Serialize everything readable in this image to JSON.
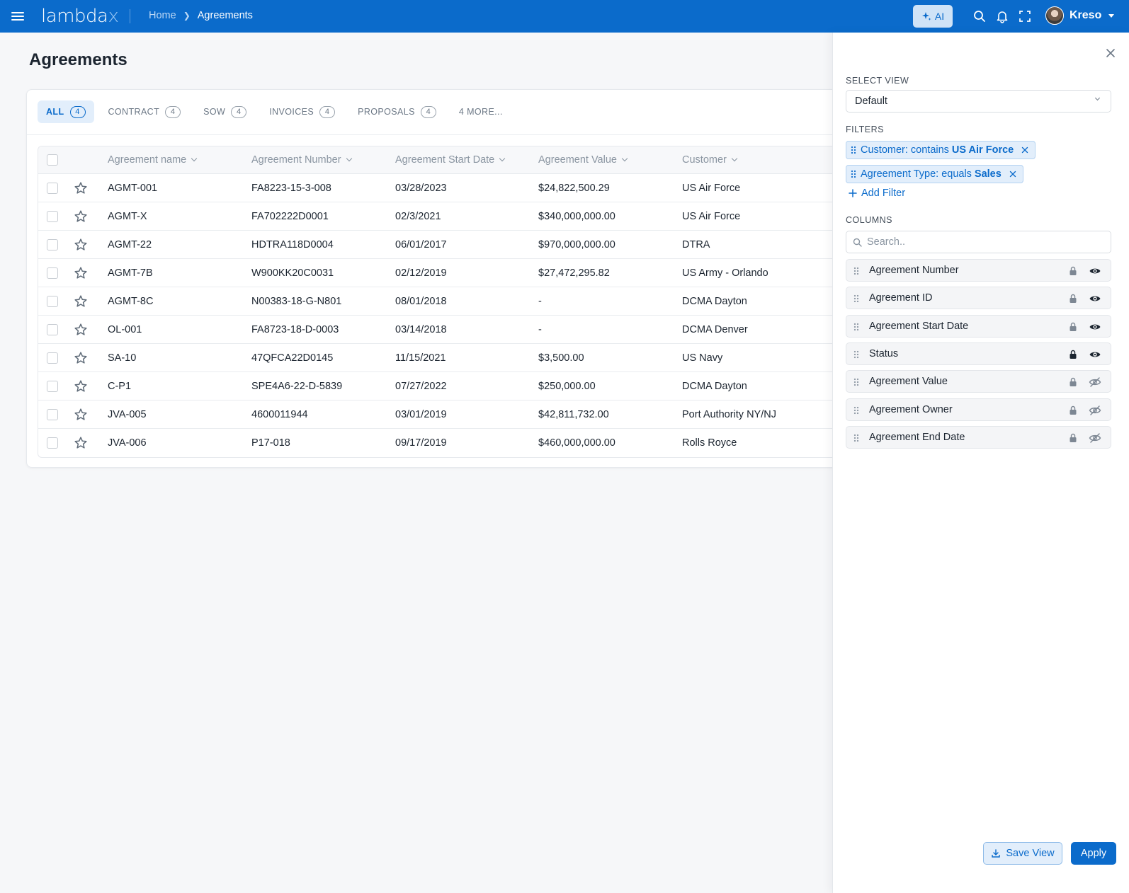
{
  "app": {
    "logo_main": "lambda",
    "logo_accent": "x"
  },
  "breadcrumb": {
    "home": "Home",
    "current": "Agreements"
  },
  "header": {
    "ai_label": "AI",
    "user_name": "Kreso"
  },
  "page": {
    "title": "Agreements"
  },
  "tabs": [
    {
      "label": "ALL",
      "count": "4",
      "active": true
    },
    {
      "label": "CONTRACT",
      "count": "4"
    },
    {
      "label": "SOW",
      "count": "4"
    },
    {
      "label": "INVOICES",
      "count": "4"
    },
    {
      "label": "PROPOSALS",
      "count": "4"
    },
    {
      "label": "4 MORE...",
      "count": ""
    }
  ],
  "table": {
    "columns": [
      "Agreement name",
      "Agreement Number",
      "Agreement Start Date",
      "Agreement Value",
      "Customer"
    ],
    "rows": [
      [
        "AGMT-001",
        "FA8223-15-3-008",
        "03/28/2023",
        "$24,822,500.29",
        "US Air Force"
      ],
      [
        "AGMT-X",
        "FA702222D0001",
        "02/3/2021",
        "$340,000,000.00",
        "US Air Force"
      ],
      [
        "AGMT-22",
        "HDTRA118D0004",
        "06/01/2017",
        "$970,000,000.00",
        "DTRA"
      ],
      [
        "AGMT-7B",
        "W900KK20C0031",
        "02/12/2019",
        "$27,472,295.82",
        "US Army - Orlando"
      ],
      [
        "AGMT-8C",
        "N00383-18-G-N801",
        "08/01/2018",
        "-",
        "DCMA Dayton"
      ],
      [
        "OL-001",
        "FA8723-18-D-0003",
        "03/14/2018",
        "-",
        "DCMA Denver"
      ],
      [
        "SA-10",
        "47QFCA22D0145",
        "11/15/2021",
        "$3,500.00",
        "US Navy"
      ],
      [
        "C-P1",
        "SPE4A6-22-D-5839",
        "07/27/2022",
        "$250,000.00",
        "DCMA Dayton"
      ],
      [
        "JVA-005",
        "4600011944",
        "03/01/2019",
        "$42,811,732.00",
        "Port Authority NY/NJ"
      ],
      [
        "JVA-006",
        "P17-018",
        "09/17/2019",
        "$460,000,000.00",
        "Rolls Royce"
      ]
    ]
  },
  "panel": {
    "select_view_label": "SELECT VIEW",
    "select_view_value": "Default",
    "filters_label": "FILTERS",
    "filters": [
      {
        "prefix": "Customer: contains",
        "value": "US Air Force"
      },
      {
        "prefix": "Agreement Type: equals",
        "value": "Sales"
      }
    ],
    "add_filter": "Add Filter",
    "columns_label": "COLUMNS",
    "columns_search_placeholder": "Search..",
    "columns": [
      {
        "name": "Agreement Number",
        "locked": false,
        "visible": true
      },
      {
        "name": "Agreement ID",
        "locked": false,
        "visible": true
      },
      {
        "name": "Agreement Start Date",
        "locked": false,
        "visible": true
      },
      {
        "name": "Status",
        "locked": true,
        "visible": true
      },
      {
        "name": "Agreement Value",
        "locked": false,
        "visible": false
      },
      {
        "name": "Agreement Owner",
        "locked": false,
        "visible": false
      },
      {
        "name": "Agreement End Date",
        "locked": false,
        "visible": false
      }
    ],
    "save_view": "Save View",
    "apply": "Apply"
  },
  "colors": {
    "brand": "#0b6bcb",
    "chip_bg": "#e2eefb",
    "page_bg": "#f6f7f9"
  }
}
